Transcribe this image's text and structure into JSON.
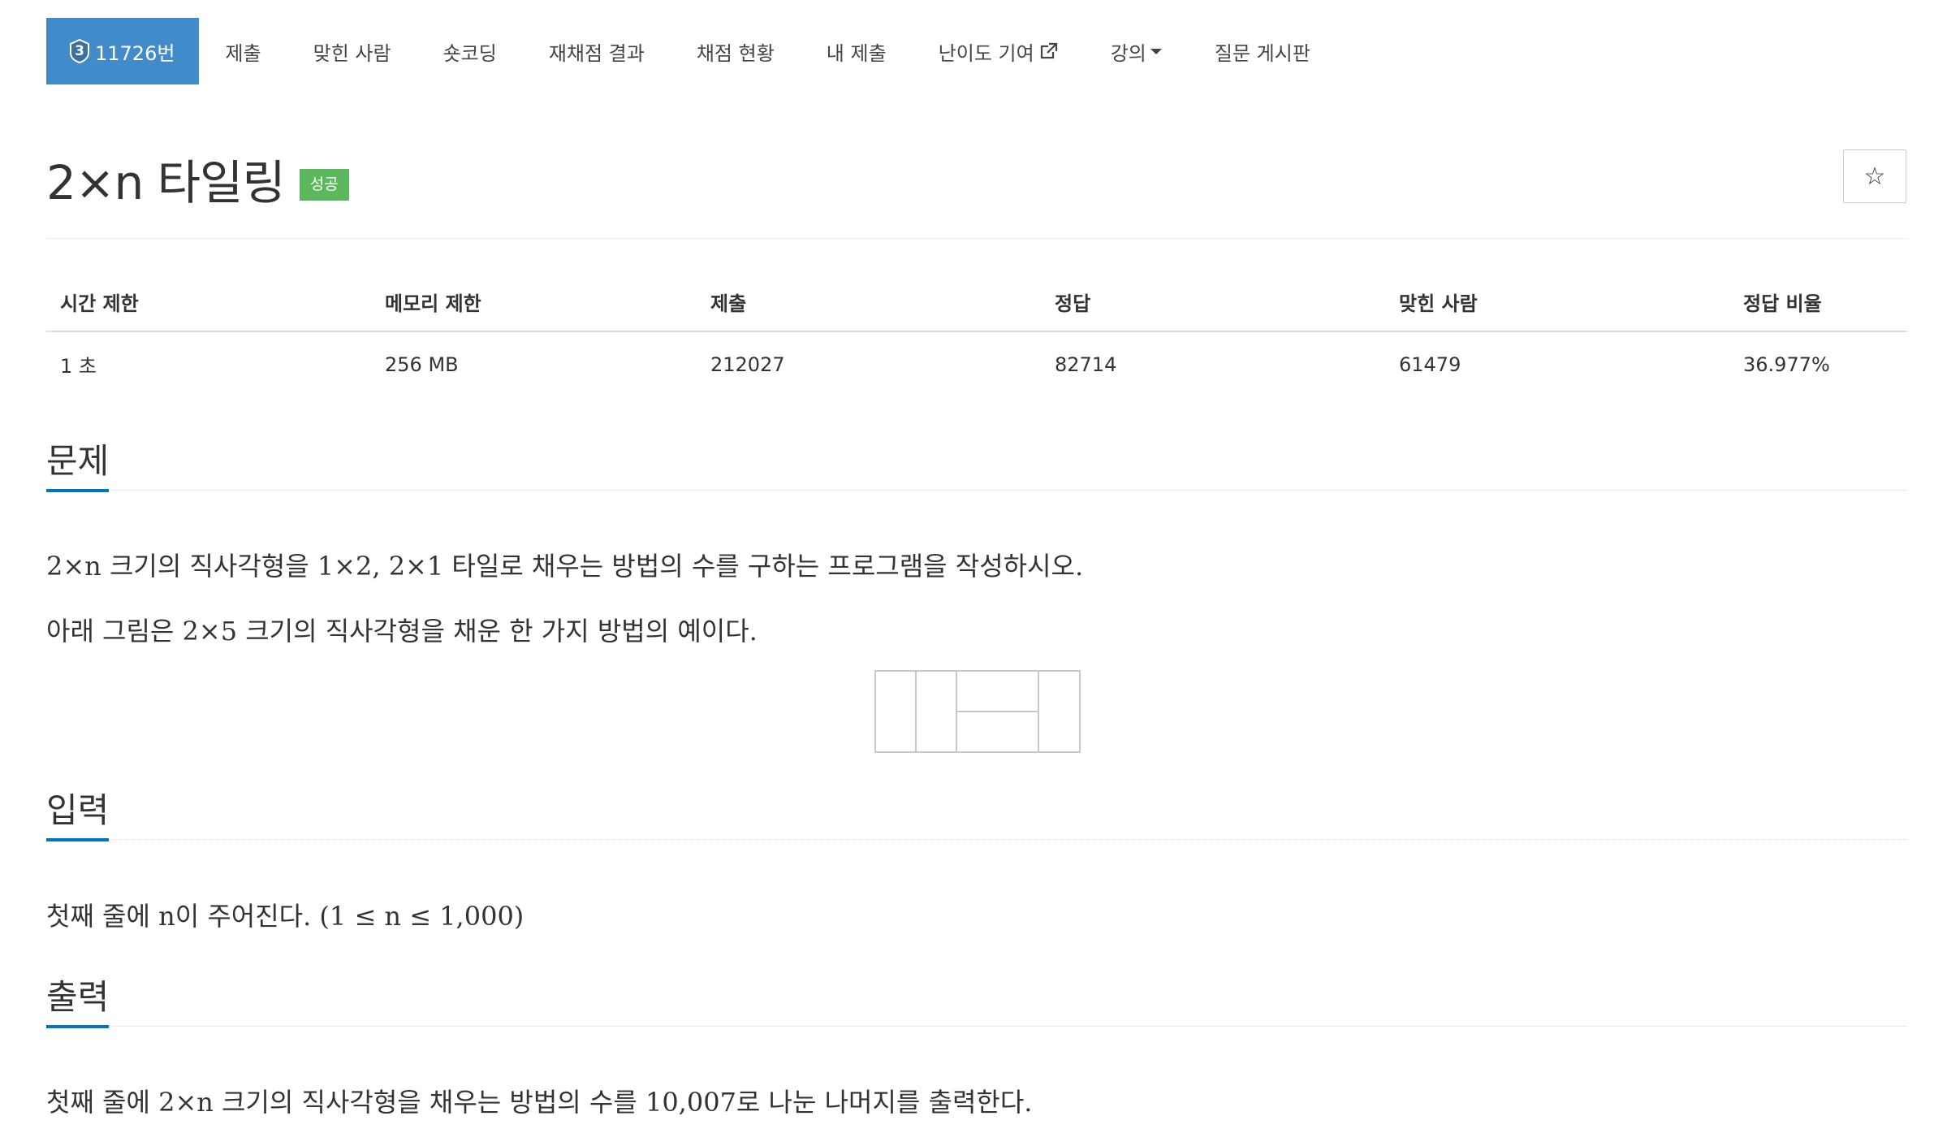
{
  "tabs": {
    "problem": {
      "tier": "3",
      "label": "11726번"
    },
    "submit": "제출",
    "solvers": "맞힌 사람",
    "shortcoding": "숏코딩",
    "rejudge_result": "재채점 결과",
    "judge_status": "채점 현황",
    "my_submissions": "내 제출",
    "difficulty": "난이도 기여",
    "lectures": "강의",
    "board": "질문 게시판"
  },
  "problem": {
    "title": "2×n 타일링",
    "status": "성공",
    "star": "☆"
  },
  "info_table": {
    "headers": [
      "시간 제한",
      "메모리 제한",
      "제출",
      "정답",
      "맞힌 사람",
      "정답 비율"
    ],
    "values": [
      "1 초",
      "256 MB",
      "212027",
      "82714",
      "61479",
      "36.977%"
    ]
  },
  "sections": {
    "description": {
      "heading": "문제",
      "line1": "2×n 크기의 직사각형을 1×2, 2×1 타일로 채우는 방법의 수를 구하는 프로그램을 작성하시오.",
      "line2": "아래 그림은 2×5 크기의 직사각형을 채운 한 가지 방법의 예이다."
    },
    "input": {
      "heading": "입력",
      "text": "첫째 줄에 n이 주어진다. (1 ≤ n ≤ 1,000)"
    },
    "output": {
      "heading": "출력",
      "text": "첫째 줄에 2×n 크기의 직사각형을 채우는 방법의 수를 10,007로 나눈 나머지를 출력한다."
    }
  },
  "colors": {
    "active_tab": "#428bca",
    "success": "#5cb85c",
    "section_accent": "#0076c0"
  },
  "icons": {
    "tier": "tier-badge-icon",
    "external_link": "external-link-icon",
    "caret": "caret-down-icon",
    "star": "star-icon"
  }
}
